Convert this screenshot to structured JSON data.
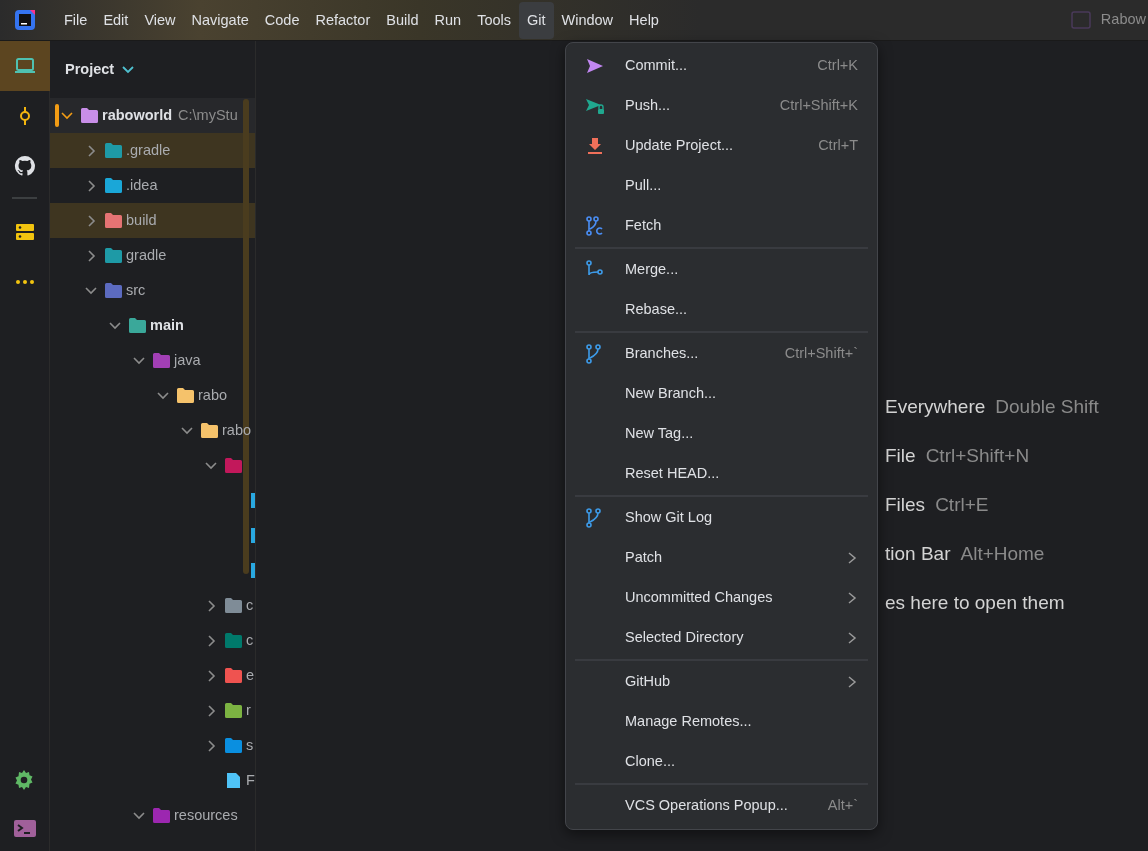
{
  "menubar": [
    {
      "label": "File",
      "selected": false
    },
    {
      "label": "Edit",
      "selected": false
    },
    {
      "label": "View",
      "selected": false
    },
    {
      "label": "Navigate",
      "selected": false
    },
    {
      "label": "Code",
      "selected": false
    },
    {
      "label": "Refactor",
      "selected": false
    },
    {
      "label": "Build",
      "selected": false
    },
    {
      "label": "Run",
      "selected": false
    },
    {
      "label": "Tools",
      "selected": false
    },
    {
      "label": "Git",
      "selected": true
    },
    {
      "label": "Window",
      "selected": false
    },
    {
      "label": "Help",
      "selected": false
    }
  ],
  "window_title": "Rabow",
  "toolstrip": [
    {
      "selected": true
    },
    {
      "selected": false
    },
    {
      "selected": false
    },
    {
      "selected": false
    },
    {
      "selected": false
    }
  ],
  "toolstrip_bottom": [
    {
      "selected": false
    },
    {
      "selected": false
    }
  ],
  "project": {
    "title": "Project",
    "tree": [
      {
        "kind": "folder",
        "label": "raboworld",
        "path": "C:\\myStu",
        "color": "#c88ee8",
        "expanded": true,
        "selected": true,
        "bold": true,
        "excluded": false,
        "children": [
          {
            "kind": "folder",
            "label": ".gradle",
            "color": "#1e9aa6",
            "expanded": false,
            "selected": false,
            "bold": false,
            "excluded": true
          },
          {
            "kind": "folder",
            "label": ".idea",
            "color": "#1aa7d8",
            "expanded": false,
            "selected": false,
            "bold": false,
            "excluded": false
          },
          {
            "kind": "folder",
            "label": "build",
            "color": "#e57373",
            "expanded": false,
            "selected": false,
            "bold": false,
            "excluded": true
          },
          {
            "kind": "folder",
            "label": "gradle",
            "color": "#1e9aa6",
            "expanded": false,
            "selected": false,
            "bold": false,
            "excluded": false
          },
          {
            "kind": "folder",
            "label": "src",
            "color": "#5c6bc0",
            "expanded": true,
            "selected": false,
            "bold": false,
            "excluded": false,
            "children": [
              {
                "kind": "folder",
                "label": "main",
                "color": "#3aa89a",
                "expanded": true,
                "selected": false,
                "bold": true,
                "excluded": false,
                "children": [
                  {
                    "kind": "folder",
                    "label": "java",
                    "color": "#a23fb5",
                    "expanded": true,
                    "selected": false,
                    "bold": false,
                    "excluded": false,
                    "children": [
                      {
                        "kind": "folder",
                        "label": "rabo",
                        "color": "#f5c26b",
                        "expanded": true,
                        "selected": false,
                        "bold": false,
                        "excluded": false,
                        "children": [
                          {
                            "kind": "folder",
                            "label": "rabo",
                            "color": "#f5c26b",
                            "expanded": true,
                            "selected": false,
                            "bold": false,
                            "excluded": false,
                            "children": [
                              {
                                "kind": "folder",
                                "color": "#c2185b",
                                "expanded": true,
                                "selected": false,
                                "bold": false,
                                "excluded": false,
                                "children": [
                                  {
                                    "color": "#29a8e0",
                                    "selected": false,
                                    "bold": false,
                                    "excluded": false
                                  },
                                  {
                                    "color": "#29a8e0",
                                    "selected": false,
                                    "bold": false,
                                    "excluded": false
                                  },
                                  {
                                    "color": "#29a8e0",
                                    "selected": false,
                                    "bold": false,
                                    "excluded": false
                                  }
                                ]
                              },
                              {
                                "kind": "folder",
                                "label": "c",
                                "color": "#7f8c97",
                                "expanded": false,
                                "selected": false,
                                "bold": false,
                                "excluded": false
                              },
                              {
                                "kind": "folder",
                                "label": "c",
                                "color": "#00796b",
                                "expanded": false,
                                "selected": false,
                                "bold": false,
                                "excluded": false
                              },
                              {
                                "kind": "folder",
                                "label": "e",
                                "color": "#ef5350",
                                "expanded": false,
                                "selected": false,
                                "bold": false,
                                "excluded": false
                              },
                              {
                                "kind": "folder",
                                "label": "r",
                                "color": "#7cb342",
                                "expanded": false,
                                "selected": false,
                                "bold": false,
                                "excluded": false
                              },
                              {
                                "kind": "folder",
                                "label": "s",
                                "color": "#0a8fe0",
                                "expanded": false,
                                "selected": false,
                                "bold": false,
                                "excluded": false
                              },
                              {
                                "kind": "file",
                                "label": "F",
                                "color": "#4fc3f7",
                                "selected": false,
                                "bold": false,
                                "excluded": false
                              }
                            ]
                          }
                        ]
                      }
                    ]
                  },
                  {
                    "kind": "folder",
                    "label": "resources",
                    "color": "#9c27b0",
                    "expanded": true,
                    "selected": false,
                    "bold": false,
                    "excluded": false
                  }
                ]
              }
            ]
          }
        ]
      }
    ]
  },
  "git_menu": [
    [
      {
        "label": "Commit...",
        "shortcut": "Ctrl+K",
        "submenu": false
      },
      {
        "label": "Push...",
        "shortcut": "Ctrl+Shift+K",
        "submenu": false
      },
      {
        "label": "Update Project...",
        "shortcut": "Ctrl+T",
        "submenu": false
      },
      {
        "label": "Pull...",
        "submenu": false
      },
      {
        "label": "Fetch",
        "submenu": false
      }
    ],
    [
      {
        "label": "Merge...",
        "submenu": false
      },
      {
        "label": "Rebase...",
        "submenu": false
      }
    ],
    [
      {
        "label": "Branches...",
        "shortcut": "Ctrl+Shift+`",
        "submenu": false
      },
      {
        "label": "New Branch...",
        "submenu": false
      },
      {
        "label": "New Tag...",
        "submenu": false
      },
      {
        "label": "Reset HEAD...",
        "submenu": false
      }
    ],
    [
      {
        "label": "Show Git Log",
        "submenu": false
      },
      {
        "label": "Patch",
        "submenu": true
      },
      {
        "label": "Uncommitted Changes",
        "submenu": true
      },
      {
        "label": "Selected Directory",
        "submenu": true
      }
    ],
    [
      {
        "label": "GitHub",
        "submenu": true
      },
      {
        "label": "Manage Remotes...",
        "submenu": false
      },
      {
        "label": "Clone...",
        "submenu": false
      }
    ],
    [
      {
        "label": "VCS Operations Popup...",
        "shortcut": "Alt+`",
        "submenu": false
      }
    ]
  ],
  "editor_hints": [
    {
      "action": "Everywhere",
      "shortcut": "Double Shift"
    },
    {
      "action": "File",
      "shortcut": "Ctrl+Shift+N"
    },
    {
      "action": "Files",
      "shortcut": "Ctrl+E"
    },
    {
      "action": "tion Bar",
      "shortcut": "Alt+Home"
    },
    {
      "action": "es here to open them"
    }
  ]
}
